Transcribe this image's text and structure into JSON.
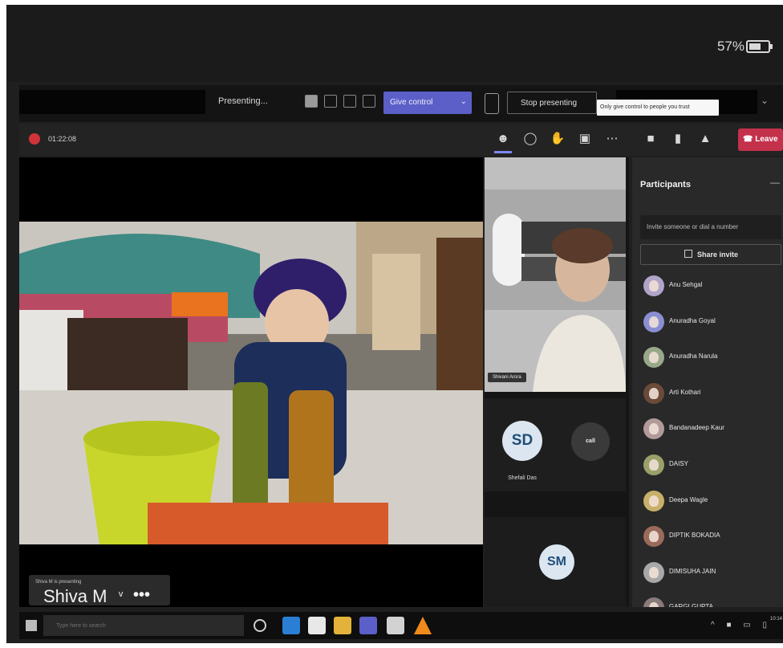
{
  "device": {
    "battery_percent": "57%"
  },
  "presenting_bar": {
    "status_label": "Presenting...",
    "give_control_label": "Give control",
    "stop_presenting_label": "Stop presenting",
    "tooltip": "Only give control to people you trust"
  },
  "meeting": {
    "timer": "01:22:08",
    "leave_label": "Leave"
  },
  "stage": {
    "presenter_name": "Shiva M",
    "presenter_caption": "Shiva M is presenting"
  },
  "tiles": {
    "teacher_name_tag": "Shivani Arora",
    "sd_initials": "SD",
    "sd_name": "Shefali Das",
    "nt_initials": "call",
    "sm_initials": "SM"
  },
  "participants": {
    "title": "Participants",
    "invite_placeholder": "Invite someone or dial a number",
    "share_invite_label": "Share invite",
    "people": [
      {
        "name": "Anu Sehgal",
        "color": "#b0a4c8"
      },
      {
        "name": "Anuradha Goyal",
        "color": "#8a8fd3"
      },
      {
        "name": "Anuradha Narula",
        "color": "#98a88a"
      },
      {
        "name": "Arti Kothari",
        "color": "#6b4a3a"
      },
      {
        "name": "Bandanadeep Kaur",
        "color": "#b19a9a"
      },
      {
        "name": "DAISY",
        "color": "#9aa06a"
      },
      {
        "name": "Deepa Wagle",
        "color": "#c9b06a"
      },
      {
        "name": "DIPTIK BOKADIA",
        "color": "#9a6a5a"
      },
      {
        "name": "DIMISUHA JAIN",
        "color": "#a8a8a8"
      },
      {
        "name": "GARGI GUPTA",
        "color": "#8a7a7a"
      }
    ]
  },
  "taskbar": {
    "search_placeholder": "Type here to search",
    "clock": "10:14"
  },
  "colors": {
    "accent": "#5b5fc7",
    "leave": "#c4314b",
    "recording": "#d13438"
  }
}
